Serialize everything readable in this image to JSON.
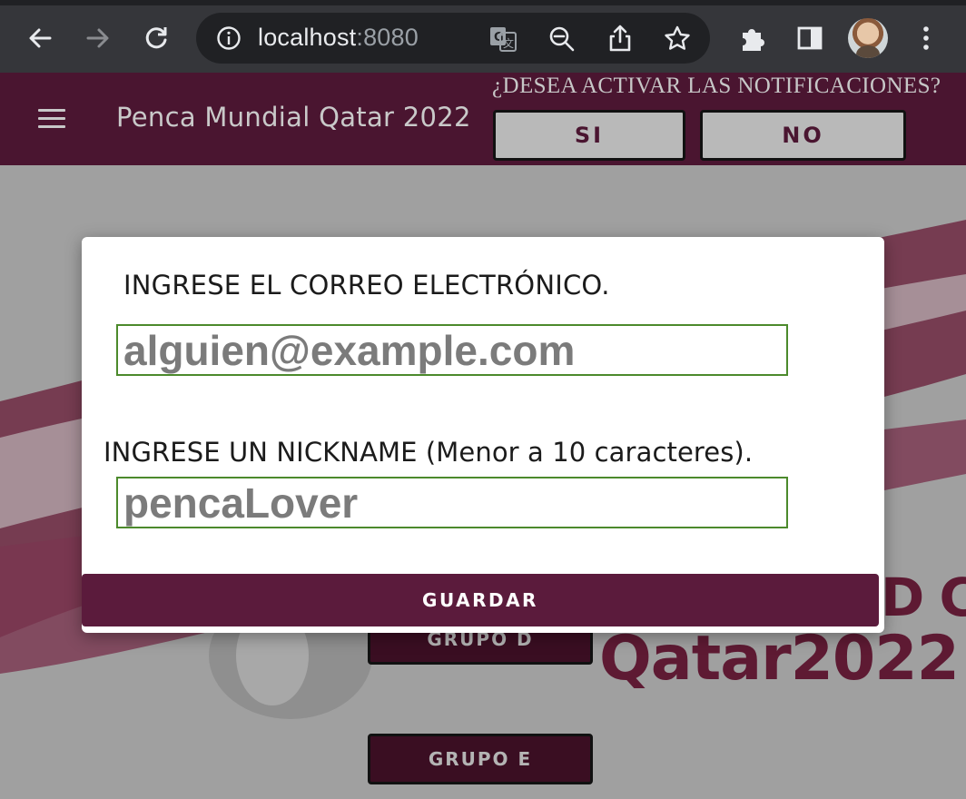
{
  "browser": {
    "url_host": "localhost",
    "url_port": ":8080",
    "icons": [
      "back-arrow-icon",
      "forward-arrow-icon",
      "reload-icon",
      "site-info-icon",
      "translate-icon",
      "zoom-out-icon",
      "share-icon",
      "bookmark-star-icon",
      "extensions-icon",
      "side-panel-icon",
      "profile-avatar",
      "more-menu-icon"
    ]
  },
  "header": {
    "title": "Penca Mundial Qatar 2022",
    "notification_question": "¿DESEA ACTIVAR LAS NOTIFICACIONES?",
    "yes_label": "SI",
    "no_label": "NO"
  },
  "background": {
    "group_d_label": "GRUPO D",
    "group_e_label": "GRUPO E",
    "brand_line1": "FIFA WORLD CU",
    "brand_line2": "Qatar2022"
  },
  "modal": {
    "email_label": "INGRESE EL CORREO ELECTRÓNICO.",
    "email_placeholder": "alguien@example.com",
    "nickname_label": "INGRESE UN NICKNAME (Menor a 10 caracteres).",
    "nickname_placeholder": "pencaLover",
    "save_label": "GUARDAR"
  },
  "colors": {
    "brand_maroon": "#5b1b3c",
    "header_maroon": "#4a1530",
    "input_border_green": "#4c8a2c"
  }
}
